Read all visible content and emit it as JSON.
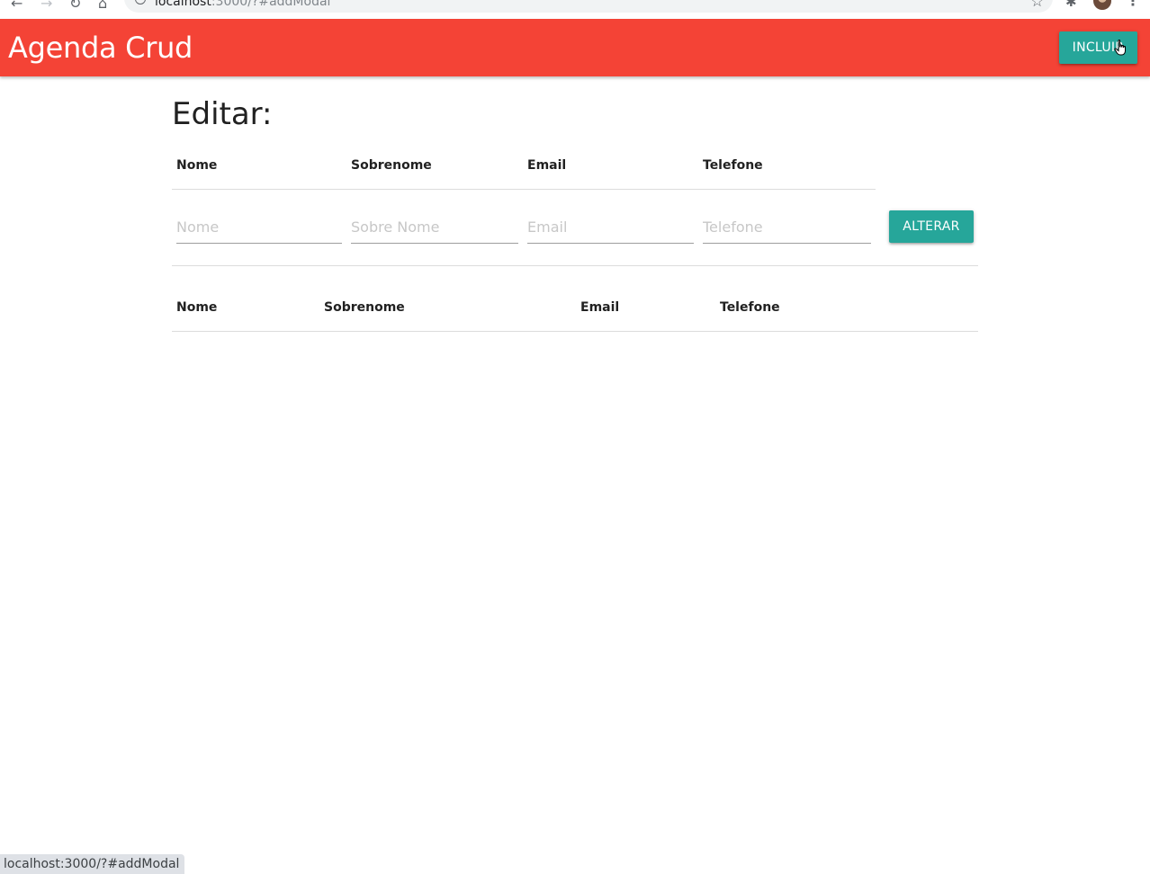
{
  "browser": {
    "url_host": "localhost",
    "url_rest": ":3000/?#addModal",
    "back_icon": "arrow-back-icon",
    "forward_icon": "arrow-forward-icon",
    "reload_icon": "reload-icon",
    "home_icon": "home-icon"
  },
  "header": {
    "brand": "Agenda Crud",
    "incluir_label": "INCLUIR",
    "background_color": "#f44336",
    "button_color": "#26a69a"
  },
  "edit": {
    "title": "Editar:",
    "columns": [
      "Nome",
      "Sobrenome",
      "Email",
      "Telefone"
    ],
    "placeholders": {
      "nome": "Nome",
      "sobrenome": "Sobre Nome",
      "email": "Email",
      "telefone": "Telefone"
    },
    "alterar_label": "ALTERAR"
  },
  "list": {
    "columns": [
      "Nome",
      "Sobrenome",
      "Email",
      "Telefone"
    ]
  },
  "status_bar": {
    "url": "localhost:3000/?#addModal"
  }
}
